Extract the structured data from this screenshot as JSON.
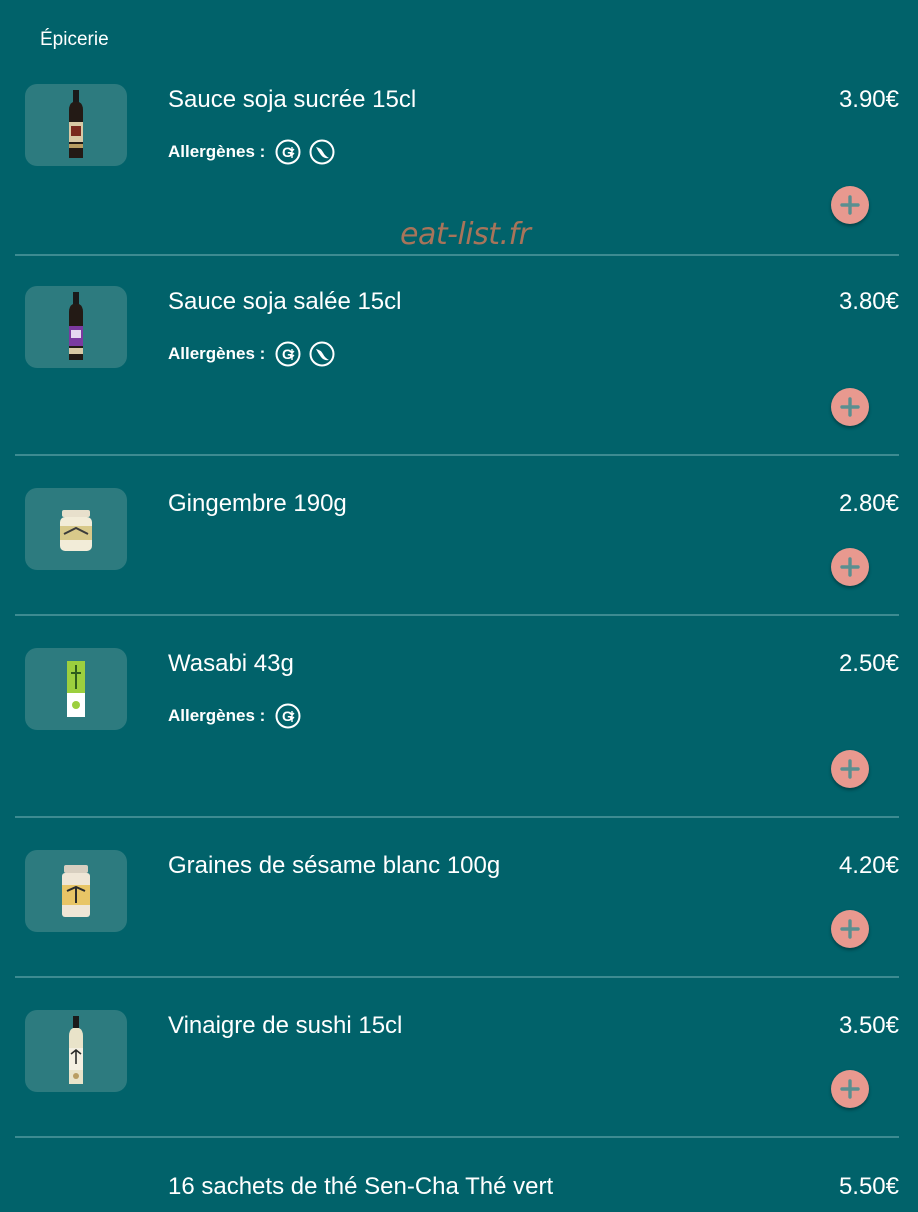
{
  "category": {
    "title": "Épicerie"
  },
  "watermark": "eat-list.fr",
  "labels": {
    "allergens": "Allergènes :"
  },
  "colors": {
    "background": "#01626a",
    "divider": "#3d8b91",
    "thumb_bg": "#2d7b7f",
    "add_button": "#e8998f",
    "add_icon": "#5a8f90",
    "watermark": "#a8745a"
  },
  "items": [
    {
      "name": "Sauce soja sucrée 15cl",
      "price": "3.90€",
      "image": "soy-sauce-bottle",
      "allergens": [
        "gluten-icon",
        "soy-icon"
      ]
    },
    {
      "name": "Sauce soja salée 15cl",
      "price": "3.80€",
      "image": "soy-sauce-bottle-purple",
      "allergens": [
        "gluten-icon",
        "soy-icon"
      ]
    },
    {
      "name": "Gingembre 190g",
      "price": "2.80€",
      "image": "ginger-jar",
      "allergens": []
    },
    {
      "name": "Wasabi 43g",
      "price": "2.50€",
      "image": "wasabi-tube",
      "allergens": [
        "gluten-icon"
      ]
    },
    {
      "name": "Graines de sésame blanc 100g",
      "price": "4.20€",
      "image": "sesame-jar",
      "allergens": []
    },
    {
      "name": "Vinaigre de sushi 15cl",
      "price": "3.50€",
      "image": "vinegar-bottle",
      "allergens": []
    },
    {
      "name": "16 sachets de thé Sen-Cha Thé vert",
      "price": "5.50€",
      "image": "",
      "allergens": []
    }
  ]
}
